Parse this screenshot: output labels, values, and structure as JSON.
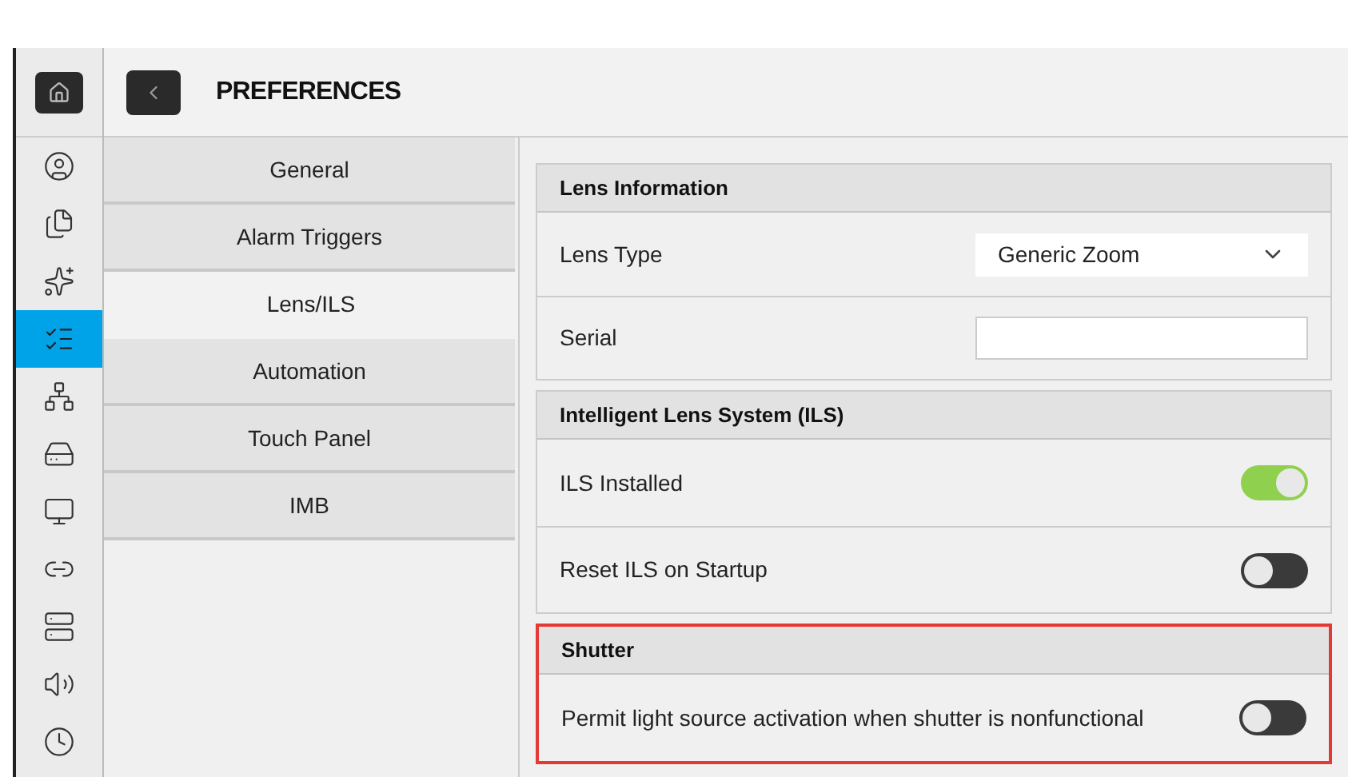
{
  "sidebar": {
    "items": [
      {
        "kind": "home",
        "selected": false
      },
      {
        "kind": "user",
        "selected": false
      },
      {
        "kind": "files",
        "selected": false
      },
      {
        "kind": "lamp",
        "selected": false
      },
      {
        "kind": "list",
        "selected": true
      },
      {
        "kind": "network",
        "selected": false
      },
      {
        "kind": "drive",
        "selected": false
      },
      {
        "kind": "stand",
        "selected": false
      },
      {
        "kind": "link",
        "selected": false
      },
      {
        "kind": "server",
        "selected": false
      },
      {
        "kind": "speaker",
        "selected": false
      },
      {
        "kind": "clock",
        "selected": false
      }
    ]
  },
  "header": {
    "title": "PREFERENCES"
  },
  "tabs": [
    {
      "label": "General",
      "selected": false
    },
    {
      "label": "Alarm Triggers",
      "selected": false
    },
    {
      "label": "Lens/ILS",
      "selected": true
    },
    {
      "label": "Automation",
      "selected": false
    },
    {
      "label": "Touch Panel",
      "selected": false
    },
    {
      "label": "IMB",
      "selected": false
    }
  ],
  "sections": [
    {
      "title": "Lens Information",
      "highlighted": false,
      "rows": [
        {
          "kind": "select",
          "label": "Lens Type",
          "value": "Generic Zoom"
        },
        {
          "kind": "input",
          "label": "Serial"
        }
      ]
    },
    {
      "title": "Intelligent Lens System (ILS)",
      "highlighted": false,
      "rows": [
        {
          "kind": "toggle",
          "label": "ILS Installed",
          "on": true
        },
        {
          "kind": "toggle",
          "label": "Reset ILS on Startup",
          "on": false
        }
      ]
    },
    {
      "title": "Shutter",
      "highlighted": true,
      "rows": [
        {
          "kind": "toggle",
          "label": "Permit light source activation when shutter is nonfunctional",
          "on": false
        }
      ]
    }
  ]
}
